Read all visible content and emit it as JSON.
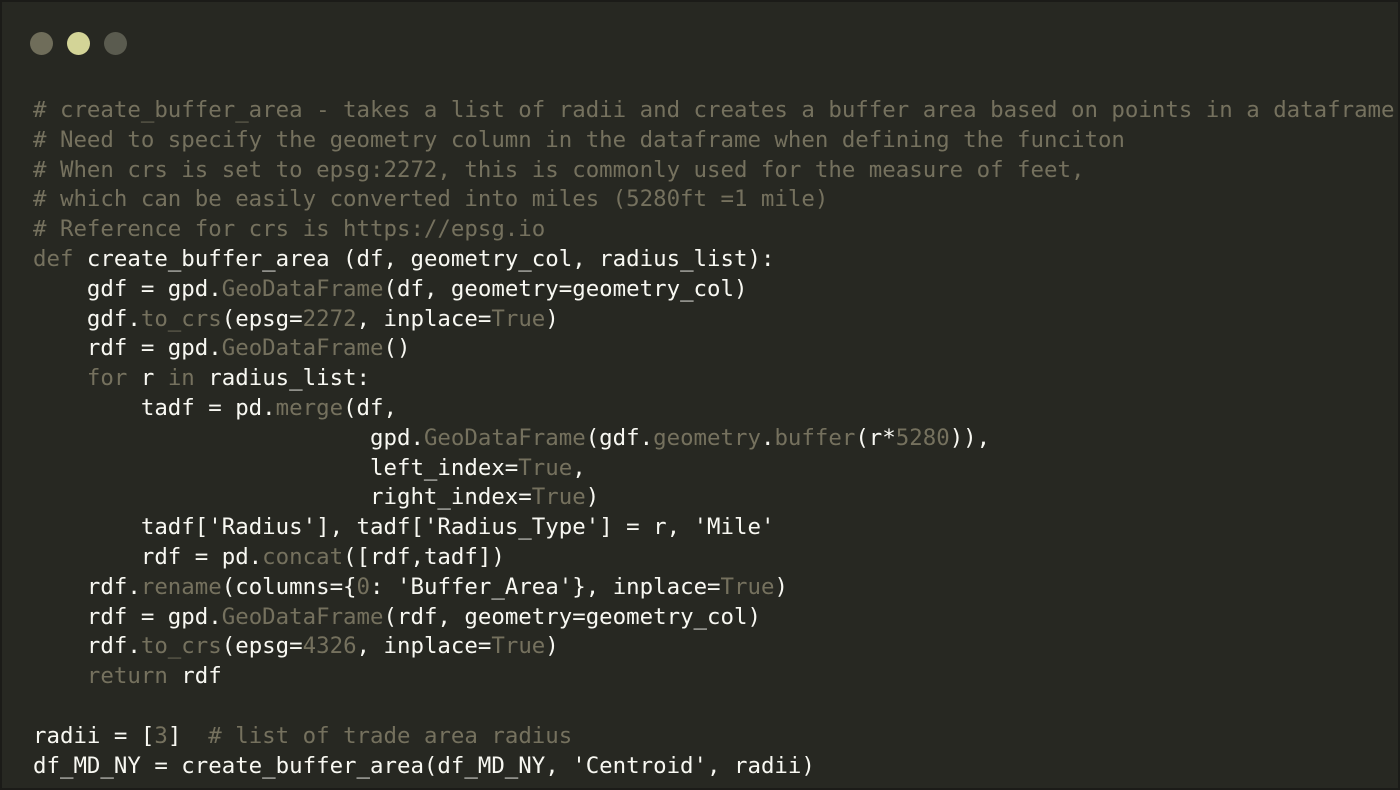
{
  "window_controls": [
    {
      "name": "close-button",
      "color": "#6f6d5a"
    },
    {
      "name": "minimize-button",
      "color": "#d3d497"
    },
    {
      "name": "maximize-button",
      "color": "#5a5b4f"
    }
  ],
  "colors": {
    "background": "#272822",
    "comment": "#75715e",
    "keyword": "#66d9ef",
    "function": "#a6e22e",
    "string": "#e6db74",
    "number": "#ae81ff",
    "text": "#f8f8f2"
  },
  "code_lines": [
    [
      {
        "t": "# create_buffer_area - takes a list of radii and creates a buffer area based on points in a dataframe",
        "k": "comment"
      }
    ],
    [
      {
        "t": "# Need to specify the geometry column in the dataframe when defining the funciton",
        "k": "comment"
      }
    ],
    [
      {
        "t": "# When crs is set to epsg:2272, this is commonly used for the measure of feet,",
        "k": "comment"
      }
    ],
    [
      {
        "t": "# which can be easily converted into miles (5280ft =1 mile)",
        "k": "comment"
      }
    ],
    [
      {
        "t": "# Reference for crs is https://epsg.io",
        "k": "comment"
      }
    ],
    [
      {
        "t": "def",
        "k": "comment"
      },
      {
        "t": " create_buffer_area (df, geometry_col, radius_list):",
        "k": "plain"
      }
    ],
    [
      {
        "t": "    gdf = gpd.",
        "k": "plain"
      },
      {
        "t": "GeoDataFrame",
        "k": "comment"
      },
      {
        "t": "(df, geometry=geometry_col)",
        "k": "plain"
      }
    ],
    [
      {
        "t": "    gdf.",
        "k": "plain"
      },
      {
        "t": "to_crs",
        "k": "comment"
      },
      {
        "t": "(epsg=",
        "k": "plain"
      },
      {
        "t": "2272",
        "k": "comment"
      },
      {
        "t": ", inplace=",
        "k": "plain"
      },
      {
        "t": "True",
        "k": "comment"
      },
      {
        "t": ")",
        "k": "plain"
      }
    ],
    [
      {
        "t": "    rdf = gpd.",
        "k": "plain"
      },
      {
        "t": "GeoDataFrame",
        "k": "comment"
      },
      {
        "t": "()",
        "k": "plain"
      }
    ],
    [
      {
        "t": "    ",
        "k": "plain"
      },
      {
        "t": "for",
        "k": "comment"
      },
      {
        "t": " r ",
        "k": "plain"
      },
      {
        "t": "in",
        "k": "comment"
      },
      {
        "t": " radius_list:",
        "k": "plain"
      }
    ],
    [
      {
        "t": "        tadf = pd.",
        "k": "plain"
      },
      {
        "t": "merge",
        "k": "comment"
      },
      {
        "t": "(df,",
        "k": "plain"
      }
    ],
    [
      {
        "t": "                         gpd.",
        "k": "plain"
      },
      {
        "t": "GeoDataFrame",
        "k": "comment"
      },
      {
        "t": "(gdf.",
        "k": "plain"
      },
      {
        "t": "geometry",
        "k": "comment"
      },
      {
        "t": ".",
        "k": "plain"
      },
      {
        "t": "buffer",
        "k": "comment"
      },
      {
        "t": "(r*",
        "k": "plain"
      },
      {
        "t": "5280",
        "k": "comment"
      },
      {
        "t": ")),",
        "k": "plain"
      }
    ],
    [
      {
        "t": "                         left_index=",
        "k": "plain"
      },
      {
        "t": "True",
        "k": "comment"
      },
      {
        "t": ",",
        "k": "plain"
      }
    ],
    [
      {
        "t": "                         right_index=",
        "k": "plain"
      },
      {
        "t": "True",
        "k": "comment"
      },
      {
        "t": ")",
        "k": "plain"
      }
    ],
    [
      {
        "t": "        tadf[",
        "k": "plain"
      },
      {
        "t": "'Radius'",
        "k": "plain"
      },
      {
        "t": "], tadf[",
        "k": "plain"
      },
      {
        "t": "'Radius_Type'",
        "k": "plain"
      },
      {
        "t": "] = r, ",
        "k": "plain"
      },
      {
        "t": "'Mile'",
        "k": "plain"
      }
    ],
    [
      {
        "t": "        rdf = pd.",
        "k": "plain"
      },
      {
        "t": "concat",
        "k": "comment"
      },
      {
        "t": "([rdf,tadf])",
        "k": "plain"
      }
    ],
    [
      {
        "t": "    rdf.",
        "k": "plain"
      },
      {
        "t": "rename",
        "k": "comment"
      },
      {
        "t": "(columns={",
        "k": "plain"
      },
      {
        "t": "0",
        "k": "comment"
      },
      {
        "t": ": ",
        "k": "plain"
      },
      {
        "t": "'Buffer_Area'",
        "k": "plain"
      },
      {
        "t": "}, inplace=",
        "k": "plain"
      },
      {
        "t": "True",
        "k": "comment"
      },
      {
        "t": ")",
        "k": "plain"
      }
    ],
    [
      {
        "t": "    rdf = gpd.",
        "k": "plain"
      },
      {
        "t": "GeoDataFrame",
        "k": "comment"
      },
      {
        "t": "(rdf, geometry=geometry_col)",
        "k": "plain"
      }
    ],
    [
      {
        "t": "    rdf.",
        "k": "plain"
      },
      {
        "t": "to_crs",
        "k": "comment"
      },
      {
        "t": "(epsg=",
        "k": "plain"
      },
      {
        "t": "4326",
        "k": "comment"
      },
      {
        "t": ", inplace=",
        "k": "plain"
      },
      {
        "t": "True",
        "k": "comment"
      },
      {
        "t": ")",
        "k": "plain"
      }
    ],
    [
      {
        "t": "    ",
        "k": "plain"
      },
      {
        "t": "return",
        "k": "comment"
      },
      {
        "t": " rdf",
        "k": "plain"
      }
    ],
    [
      {
        "t": "",
        "k": "plain"
      }
    ],
    [
      {
        "t": "radii = [",
        "k": "plain"
      },
      {
        "t": "3",
        "k": "comment"
      },
      {
        "t": "]  ",
        "k": "plain"
      },
      {
        "t": "# list of trade area radius",
        "k": "comment"
      }
    ],
    [
      {
        "t": "df_MD_NY = create_buffer_area(df_MD_NY, ",
        "k": "plain"
      },
      {
        "t": "'Centroid'",
        "k": "plain"
      },
      {
        "t": ", radii)",
        "k": "plain"
      }
    ]
  ]
}
